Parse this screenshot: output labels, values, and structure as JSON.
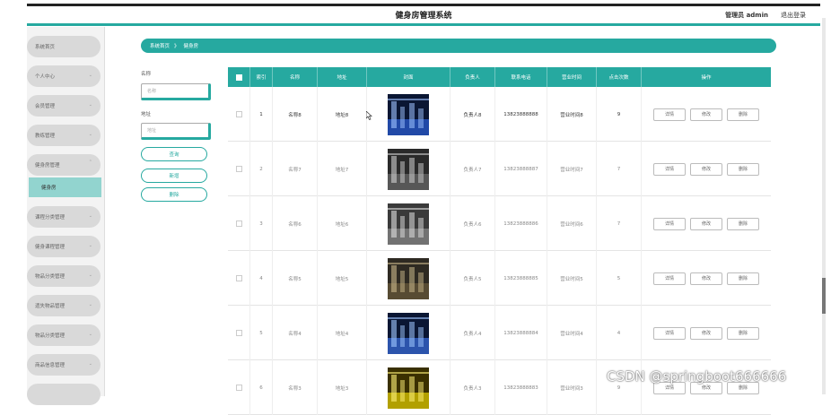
{
  "header": {
    "app_title": "健身房管理系统",
    "admin_label": "管理员 admin",
    "logout_label": "退出登录"
  },
  "sidebar": {
    "items": [
      {
        "label": "系统首页",
        "has_chevron": false
      },
      {
        "label": "个人中心",
        "has_chevron": true
      },
      {
        "label": "会员管理",
        "has_chevron": true
      },
      {
        "label": "教练管理",
        "has_chevron": true
      },
      {
        "label": "健身房管理",
        "has_chevron": true,
        "expanded": true
      },
      {
        "label": "课程分类管理",
        "has_chevron": true
      },
      {
        "label": "健身课程管理",
        "has_chevron": true
      },
      {
        "label": "物品分类管理",
        "has_chevron": true
      },
      {
        "label": "遗失物品管理",
        "has_chevron": true
      },
      {
        "label": "物品分类管理",
        "has_chevron": true
      },
      {
        "label": "商品信息管理",
        "has_chevron": true
      }
    ],
    "active_sub": "健身房"
  },
  "breadcrumb": {
    "home": "系统首页",
    "separator": "》",
    "current": "健身房"
  },
  "search": {
    "name_label": "名称",
    "name_placeholder": "名称",
    "address_label": "地址",
    "address_placeholder": "地址",
    "query_button": "查询",
    "add_button": "新增",
    "delete_button": "删除"
  },
  "table": {
    "headers": [
      "索引",
      "名称",
      "地址",
      "封面",
      "负责人",
      "联系电话",
      "营业时间",
      "点击次数",
      "操作"
    ],
    "rows": [
      {
        "index": "1",
        "name": "名称8",
        "address": "地址8",
        "manager": "负责人8",
        "phone": "13823888888",
        "hours": "营业时间8",
        "clicks": "9"
      },
      {
        "index": "2",
        "name": "名称7",
        "address": "地址7",
        "manager": "负责人7",
        "phone": "13823888887",
        "hours": "营业时间7",
        "clicks": "7"
      },
      {
        "index": "3",
        "name": "名称6",
        "address": "地址6",
        "manager": "负责人6",
        "phone": "13823888886",
        "hours": "营业时间6",
        "clicks": "7"
      },
      {
        "index": "4",
        "name": "名称5",
        "address": "地址5",
        "manager": "负责人5",
        "phone": "13823888885",
        "hours": "营业时间5",
        "clicks": "5"
      },
      {
        "index": "5",
        "name": "名称4",
        "address": "地址4",
        "manager": "负责人4",
        "phone": "13823888884",
        "hours": "营业时间4",
        "clicks": "4"
      },
      {
        "index": "6",
        "name": "名称3",
        "address": "地址3",
        "manager": "负责人3",
        "phone": "13823888883",
        "hours": "营业时间3",
        "clicks": "9"
      }
    ],
    "actions": {
      "detail": "详情",
      "edit": "修改",
      "delete": "删除"
    }
  },
  "watermark": "CSDN @springboot666666",
  "colors": {
    "accent": "#26a9a0",
    "sidebar_item": "#d9d9d9",
    "active_sub": "#92d4cf"
  }
}
